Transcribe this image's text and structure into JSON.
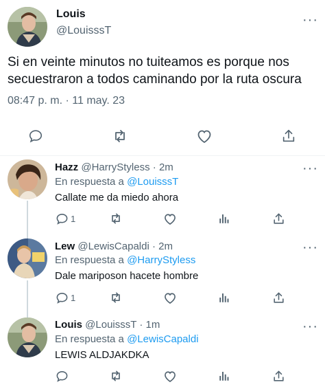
{
  "main_tweet": {
    "display_name": "Louis",
    "handle": "@LouisssT",
    "text_line1": "Si en veinte minutos no tuiteamos es porque nos",
    "text_line2": "secuestraron a todos caminando por la ruta oscura",
    "timestamp": "08:47 p. m. · 11 may. 23",
    "more_label": "···"
  },
  "replies": [
    {
      "display_name": "Hazz",
      "handle": "@HarryStyless",
      "time": "· 2m",
      "reply_prefix": "En respuesta a",
      "reply_to": "@LouisssT",
      "text": "Callate me da miedo ahora",
      "reply_count": "1"
    },
    {
      "display_name": "Lew",
      "handle": "@LewisCapaldi",
      "time": "· 2m",
      "reply_prefix": "En respuesta a",
      "reply_to": "@HarryStyless",
      "text": "Dale mariposon hacete hombre",
      "reply_count": "1"
    },
    {
      "display_name": "Louis",
      "handle": "@LouisssT",
      "time": "· 1m",
      "reply_prefix": "En respuesta a",
      "reply_to": "@LewisCapaldi",
      "text": "LEWIS ALDJAKDKA",
      "reply_count": ""
    }
  ],
  "icons": {
    "reply": "reply-icon",
    "retweet": "retweet-icon",
    "like": "like-icon",
    "views": "views-icon",
    "share": "share-icon",
    "more": "more-icon"
  },
  "colors": {
    "text": "#0f1419",
    "secondary": "#536471",
    "link": "#1d9bf0",
    "divider": "#eff3f4"
  }
}
